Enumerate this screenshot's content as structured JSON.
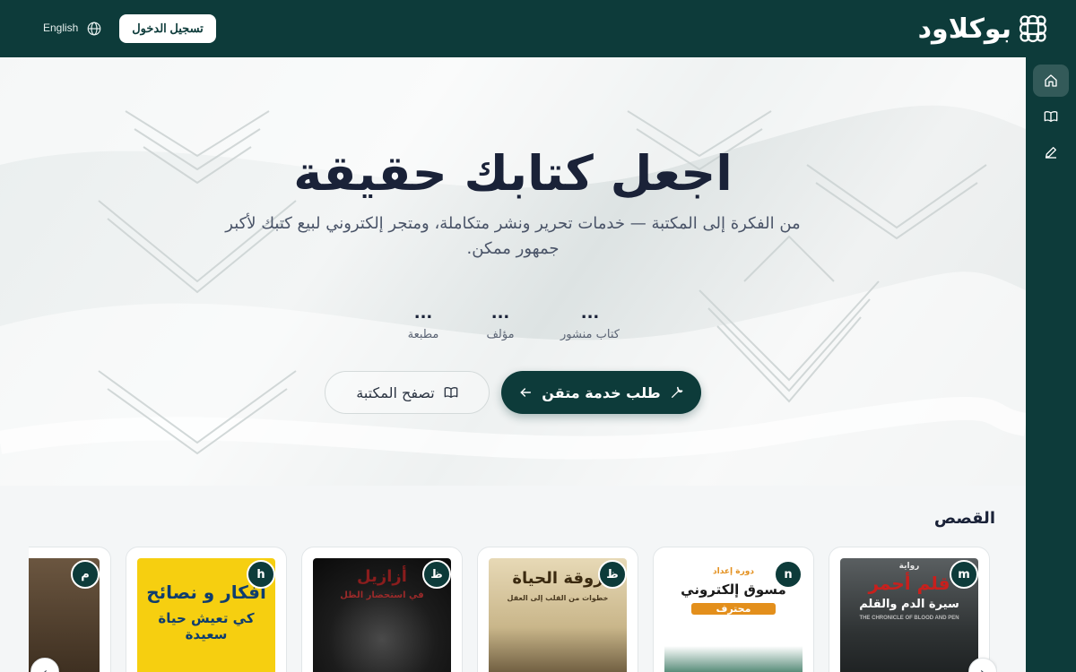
{
  "header": {
    "brand_name": "بوكلاود",
    "language_label": "English",
    "login_label": "تسجيل الدخول"
  },
  "rail": {
    "items": [
      {
        "name": "home",
        "icon": "home-icon",
        "active": true
      },
      {
        "name": "library",
        "icon": "book-icon",
        "active": false
      },
      {
        "name": "write",
        "icon": "pen-icon",
        "active": false
      }
    ]
  },
  "hero": {
    "title": "اجعل كتابك حقيقة",
    "subtitle": "من الفكرة إلى المكتبة — خدمات تحرير ونشر متكاملة، ومتجر إلكتروني لبيع كتبك لأكبر جمهور ممكن.",
    "stats": [
      {
        "value": "...",
        "label": "كتاب منشور"
      },
      {
        "value": "...",
        "label": "مؤلف"
      },
      {
        "value": "...",
        "label": "مطبعة"
      }
    ],
    "primary_button": "طلب خدمة متقن",
    "secondary_button": "تصفح المكتبة"
  },
  "stories": {
    "title": "القصص",
    "cards": [
      {
        "badge": "m",
        "cover_title": "قلم أحمر",
        "cover_sub": "سيرة الدم والقلم",
        "cover_top": "رواية",
        "cover_en": "THE CHRONICLE OF BLOOD AND PEN"
      },
      {
        "badge": "n",
        "cover_title": "مسوق إلكتروني",
        "cover_sub": "محترف",
        "cover_top": "دورة إعداد"
      },
      {
        "badge": "ظ",
        "cover_title": "روقة الحياة",
        "cover_sub": "خطوات من القلب إلى العقل"
      },
      {
        "badge": "ظ",
        "cover_title": "أزازيل",
        "cover_sub": "في استحضار الظل"
      },
      {
        "badge": "h",
        "cover_title": "أفكار و نصائح",
        "cover_sub": "كي تعيش حياة سعيدة"
      },
      {
        "badge": "م",
        "cover_title": "",
        "cover_sub": ""
      }
    ]
  },
  "colors": {
    "primary": "#0d3b3a",
    "title": "#1a2238",
    "hero_bg": "#eef1f1"
  }
}
